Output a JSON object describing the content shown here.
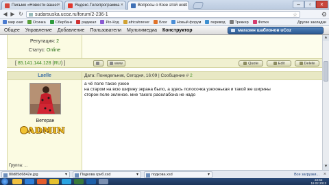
{
  "browser": {
    "tabs": [
      {
        "label": "Письмо «Новости вашег",
        "color": "#d4463b"
      },
      {
        "label": "Яндекс.Телепрограмма",
        "color": "#e1372d"
      },
      {
        "label": "Вопросы о Козе этой ucoz",
        "color": "#3f70b5"
      }
    ],
    "url": "sudarsuska.ucoz.ru/forum/2-236-1",
    "bookmarks": [
      {
        "label": "мир книг",
        "color": "#4b7bd0"
      },
      {
        "label": "Осинка",
        "color": "#5aa03c"
      },
      {
        "label": "Сбербанк",
        "color": "#2d9a3b"
      },
      {
        "label": "радикал",
        "color": "#cf3232"
      },
      {
        "label": "Pin-Код",
        "color": "#8a5ad1"
      },
      {
        "label": "africaforever",
        "color": "#d1a233"
      },
      {
        "label": "Блог",
        "color": "#e0732a"
      },
      {
        "label": "Новый форум",
        "color": "#4a8ed6"
      },
      {
        "label": "перевод",
        "color": "#3c8fd0"
      },
      {
        "label": "Треккер",
        "color": "#7a7a7a"
      },
      {
        "label": "Фотки",
        "color": "#d63c6e"
      }
    ],
    "other_bookmarks": "Другие закладки"
  },
  "ucoz_nav": {
    "items": [
      "Общее",
      "Управление",
      "Добавление",
      "Пользователи",
      "Мультимедиа",
      "Конструктор"
    ],
    "shop_button": "магазин шаблонов uCoz"
  },
  "prev_post": {
    "reputation_label": "Репутация:",
    "reputation_value": "2",
    "status_label": "Статус:",
    "status_value": "Online",
    "ip": "85.141.144.128",
    "ip_country": "RU",
    "www_label": "www"
  },
  "actions": {
    "quote": "Quote",
    "edit": "Edit",
    "delete": "Delete"
  },
  "post": {
    "author": "Laelle",
    "date_prefix": "Дата: Понедельник, Сегодня, 16:09 | Сообщение #",
    "number": "2",
    "lines": [
      "а чё поле такое узкое",
      "на старом на всю ширину экрана было, а здесь полосочка узехонькая и такой же ширины",
      "сторон поле зеленое. мне такого раселабона не надо"
    ],
    "rank": "Ветеран",
    "badge": "ADMIN",
    "cut_text": "Группа: ..."
  },
  "downloads": {
    "items": [
      "80d85d6842e.jpg",
      "Подкова гриб.xsd",
      "подкова.xsd"
    ],
    "show_all": "Все загрузки..."
  },
  "tray": {
    "time": "22:53",
    "date": "18.02.2013"
  }
}
